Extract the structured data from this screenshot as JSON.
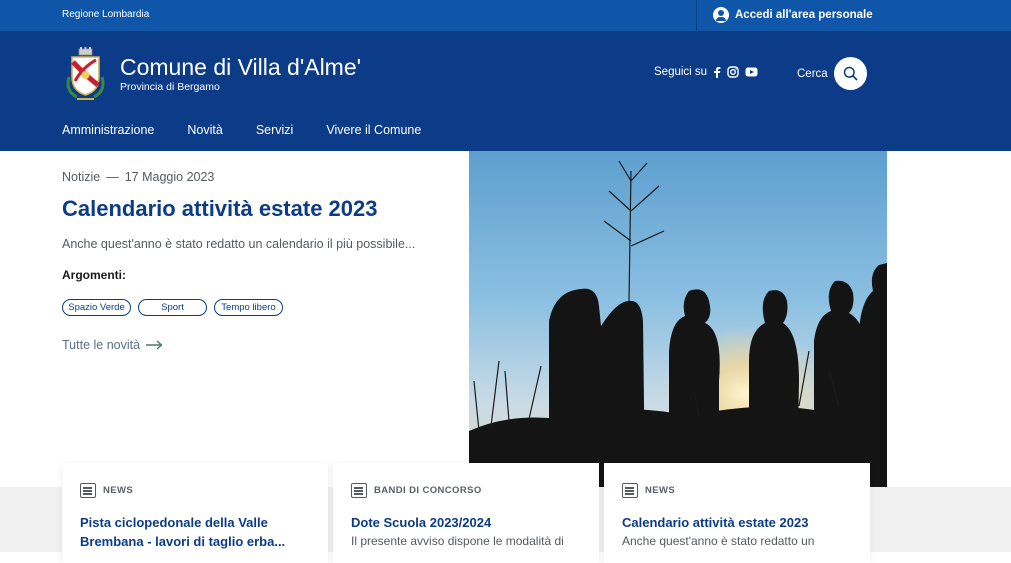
{
  "topbar": {
    "region": "Regione Lombardia",
    "login_label": "Accedi all'area personale"
  },
  "header": {
    "title": "Comune di Villa d'Alme'",
    "subtitle": "Provincia di Bergamo",
    "follow_label": "Seguici su",
    "social_icons": [
      "facebook-icon",
      "instagram-icon",
      "youtube-icon"
    ],
    "search_label": "Cerca"
  },
  "nav": {
    "items": [
      "Amministrazione",
      "Novità",
      "Servizi",
      "Vivere il Comune"
    ]
  },
  "hero": {
    "category": "Notizie",
    "separator": "—",
    "date": "17 Maggio 2023",
    "title": "Calendario attività estate 2023",
    "text": "Anche quest'anno è stato redatto un calendario il più possibile...",
    "topics_label": "Argomenti:",
    "topics": [
      "Spazio Verde",
      "Sport",
      "Tempo libero"
    ],
    "all_news_label": "Tutte le novità"
  },
  "cards": [
    {
      "category": "NEWS",
      "title": "Pista ciclopedonale della Valle Brembana - lavori di taglio erba...",
      "text": ""
    },
    {
      "category": "BANDI DI CONCORSO",
      "title": "Dote Scuola 2023/2024",
      "text": "Il presente avviso dispone le modalità di"
    },
    {
      "category": "NEWS",
      "title": "Calendario attività estate 2023",
      "text": "Anche quest'anno è stato redatto un"
    }
  ],
  "colors": {
    "topbar": "#0f55a8",
    "header": "#0c3c88",
    "accent": "#0c3c88"
  }
}
